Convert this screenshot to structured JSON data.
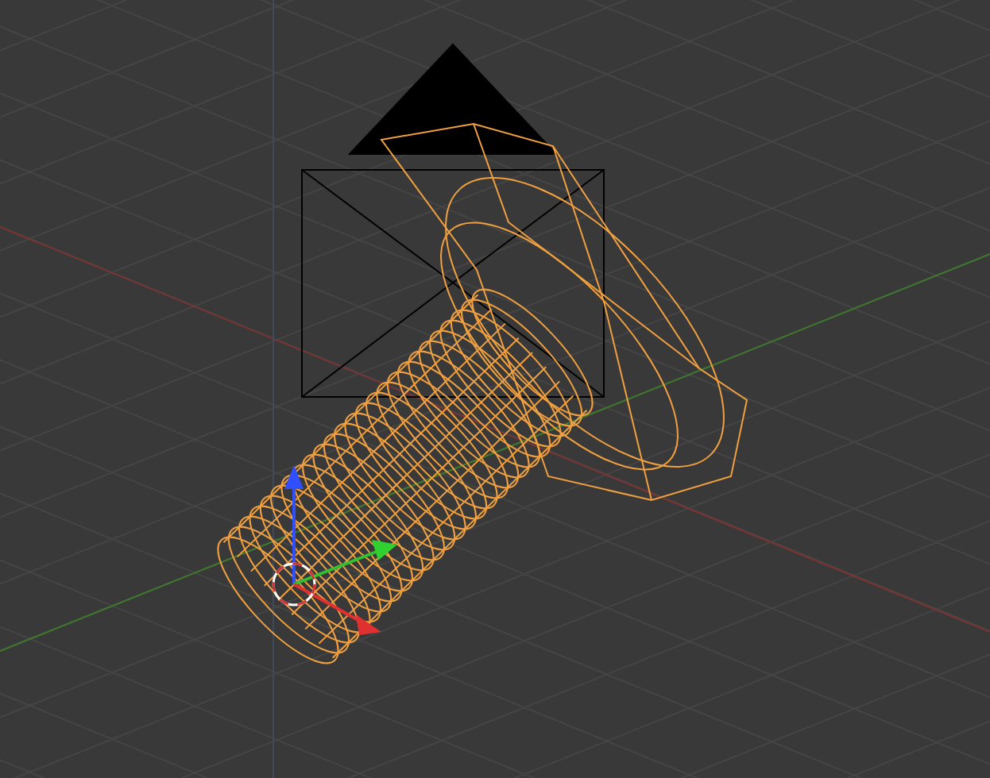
{
  "objects": [
    {
      "kind": "camera",
      "selected": false
    },
    {
      "kind": "mesh",
      "selected": true
    }
  ]
}
